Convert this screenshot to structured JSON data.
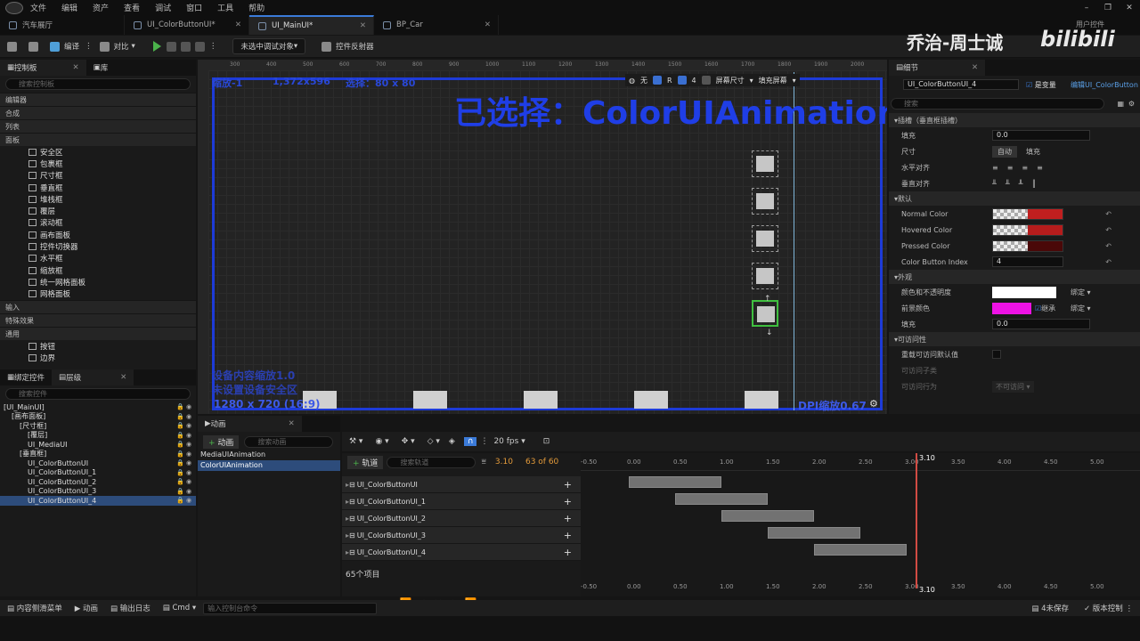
{
  "menu": [
    "文件",
    "编辑",
    "资产",
    "查看",
    "调试",
    "窗口",
    "工具",
    "帮助"
  ],
  "tabs": [
    {
      "label": "汽车展厅",
      "active": false
    },
    {
      "label": "UI_ColorButtonUI*",
      "active": false
    },
    {
      "label": "UI_MainUI*",
      "active": true
    },
    {
      "label": "BP_Car",
      "active": false
    }
  ],
  "watermark": {
    "text": "乔治-周士诚",
    "brand": "bilibili",
    "corner": "用户控件"
  },
  "toolbar": {
    "compile": "编译",
    "diff": "对比",
    "debug_target": "未选中调试对象",
    "reflector": "控件反射器"
  },
  "palette": {
    "tab1": "控制板",
    "tab2": "库",
    "search_placeholder": "搜索控制板",
    "cats_top": [
      "编辑器",
      "合成",
      "列表",
      "面板"
    ],
    "items": [
      "安全区",
      "包裹框",
      "尺寸框",
      "垂直框",
      "堆栈框",
      "覆层",
      "滚动框",
      "画布面板",
      "控件切换器",
      "水平框",
      "缩放框",
      "统一网格面板",
      "网格面板"
    ],
    "cats_bottom": [
      "输入",
      "特殊效果",
      "通用"
    ],
    "items2": [
      "按钮",
      "边界"
    ]
  },
  "hierarchy": {
    "tab1": "绑定控件",
    "tab2": "层级",
    "search_placeholder": "搜索控件",
    "rows": [
      {
        "label": "[UI_MainUI]",
        "indent": 0,
        "sel": false
      },
      {
        "label": "[画布面板]",
        "indent": 1,
        "sel": false
      },
      {
        "label": "[尺寸框]",
        "indent": 2,
        "sel": false
      },
      {
        "label": "[覆层]",
        "indent": 3,
        "sel": false
      },
      {
        "label": "UI_MediaUI",
        "indent": 3,
        "sel": false
      },
      {
        "label": "[垂直框]",
        "indent": 2,
        "sel": false
      },
      {
        "label": "UI_ColorButtonUI",
        "indent": 3,
        "sel": false
      },
      {
        "label": "UI_ColorButtonUI_1",
        "indent": 3,
        "sel": false
      },
      {
        "label": "UI_ColorButtonUI_2",
        "indent": 3,
        "sel": false
      },
      {
        "label": "UI_ColorButtonUI_3",
        "indent": 3,
        "sel": false
      },
      {
        "label": "UI_ColorButtonUI_4",
        "indent": 3,
        "sel": true
      }
    ]
  },
  "designer": {
    "ruler_ticks": [
      "300",
      "400",
      "500",
      "600",
      "700",
      "800",
      "900",
      "1000",
      "1100",
      "1200",
      "1300",
      "1400",
      "1500",
      "1600",
      "1700",
      "1800",
      "1900",
      "2000",
      "2100"
    ],
    "zoom": "缩放-1",
    "canvas_size": "1,372x596",
    "selection": "选择：80 x 80",
    "selected_overlay": "已选择：ColorUIAnimation",
    "tools": {
      "none": "无",
      "r": "R",
      "grid": "4",
      "screen_size": "屏幕尺寸",
      "fill_screen": "填充屏幕"
    },
    "device_scale": "设备内容缩放1.0",
    "device_safe": "未设置设备安全区",
    "resolution": "1280 x 720 (16:9)",
    "dpi": "DPI缩放0.67"
  },
  "details": {
    "tab": "细节",
    "name": "UI_ColorButtonUI_4",
    "is_var": "是变量",
    "edit_link": "编辑UI_ColorButton",
    "search_placeholder": "搜索",
    "slot_cat": "插槽（垂直框插槽）",
    "padding_label": "填充",
    "padding_val": "0.0",
    "size_label": "尺寸",
    "size_auto": "自动",
    "size_fill": "填充",
    "halign": "水平对齐",
    "valign": "垂直对齐",
    "default_cat": "默认",
    "normal": "Normal Color",
    "hovered": "Hovered Color",
    "pressed": "Pressed Color",
    "normal_color": "#c01f1f",
    "hovered_color": "#b51c1c",
    "pressed_color": "#4a0808",
    "index_label": "Color Button Index",
    "index_val": "4",
    "appearance_cat": "外观",
    "tint_label": "颜色和不透明度",
    "tint_color": "#ffffff",
    "bind": "绑定",
    "fg_label": "前景颜色",
    "fg_color": "#ee12e5",
    "inherit": "继承",
    "pad2_label": "填充",
    "pad2_val": "0.0",
    "access_cat": "可访问性",
    "override": "重载可访问默认值",
    "access_child": "可访问子类",
    "access_behavior": "可访问行为",
    "access_val": "不可访问"
  },
  "animations": {
    "tab": "动画",
    "add": "动画",
    "search_placeholder": "搜索动画",
    "list": [
      "MediaUIAnimation",
      "ColorUIAnimation"
    ],
    "selected": "ColorUIAnimation"
  },
  "sequencer": {
    "track_btn": "轨道",
    "search_placeholder": "搜索轨道",
    "fps": "20 fps",
    "time": "3.10",
    "frame": "63 of 60",
    "tracks": [
      "UI_ColorButtonUI",
      "UI_ColorButtonUI_1",
      "UI_ColorButtonUI_2",
      "UI_ColorButtonUI_3",
      "UI_ColorButtonUI_4"
    ],
    "count": "65个项目",
    "ticks": [
      "-0.50",
      "0.00",
      "0.50",
      "1.00",
      "1.50",
      "2.00",
      "2.50",
      "3.00",
      "3.50",
      "4.00",
      "4.50",
      "5.00"
    ],
    "tick_values": [
      -0.5,
      0,
      0.5,
      1.0,
      1.5,
      2.0,
      2.5,
      3.0,
      3.5,
      4.0,
      4.5,
      5.0
    ],
    "playhead": "3.10",
    "playhead_value": 3.1,
    "sections": [
      {
        "start": 0.0,
        "end": 1.0
      },
      {
        "start": 0.5,
        "end": 1.5
      },
      {
        "start": 1.0,
        "end": 2.0
      },
      {
        "start": 1.5,
        "end": 2.5
      },
      {
        "start": 2.0,
        "end": 3.0
      }
    ]
  },
  "status": {
    "drawer": "内容侧滑菜单",
    "anim": "动画",
    "log": "输出日志",
    "cmd": "Cmd",
    "cmd_placeholder": "输入控制台命令",
    "unsaved": "4未保存",
    "source": "版本控制"
  }
}
